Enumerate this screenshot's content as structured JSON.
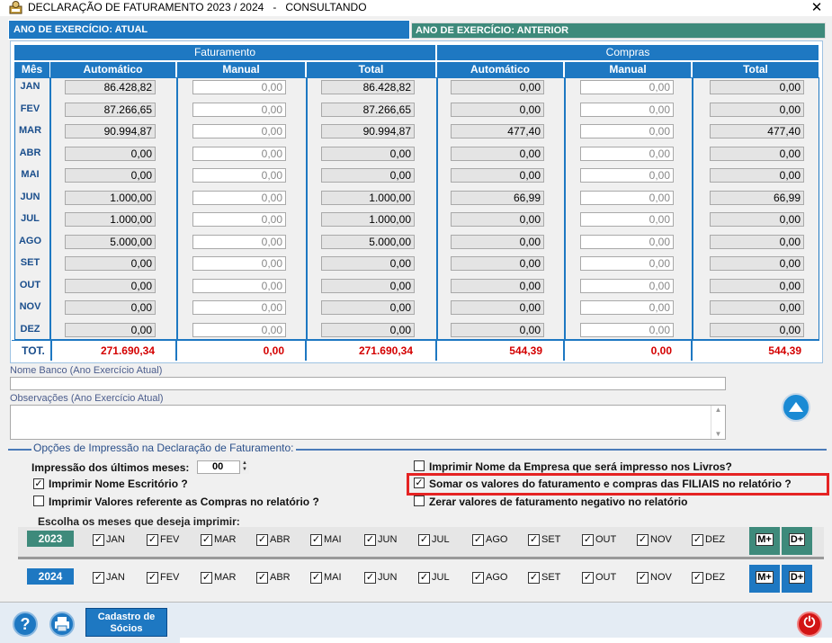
{
  "window": {
    "title": "DECLARAÇÃO DE FATURAMENTO 2023 / 2024   -   CONSULTANDO",
    "close_label": "✕"
  },
  "tabs": {
    "atual": "ANO DE EXERCÍCIO: ATUAL",
    "anterior": "ANO DE EXERCÍCIO: ANTERIOR"
  },
  "grid": {
    "group_faturamento": "Faturamento",
    "group_compras": "Compras",
    "col_mes": "Mês",
    "col_fat_auto": "Automático",
    "col_fat_manual": "Manual",
    "col_fat_total": "Total",
    "col_comp_auto": "Automático",
    "col_comp_manual": "Manual",
    "col_comp_total": "Total",
    "rows": [
      {
        "mes": "JAN",
        "fat_auto": "86.428,82",
        "fat_manual": "0,00",
        "fat_total": "86.428,82",
        "comp_auto": "0,00",
        "comp_manual": "0,00",
        "comp_total": "0,00"
      },
      {
        "mes": "FEV",
        "fat_auto": "87.266,65",
        "fat_manual": "0,00",
        "fat_total": "87.266,65",
        "comp_auto": "0,00",
        "comp_manual": "0,00",
        "comp_total": "0,00"
      },
      {
        "mes": "MAR",
        "fat_auto": "90.994,87",
        "fat_manual": "0,00",
        "fat_total": "90.994,87",
        "comp_auto": "477,40",
        "comp_manual": "0,00",
        "comp_total": "477,40"
      },
      {
        "mes": "ABR",
        "fat_auto": "0,00",
        "fat_manual": "0,00",
        "fat_total": "0,00",
        "comp_auto": "0,00",
        "comp_manual": "0,00",
        "comp_total": "0,00"
      },
      {
        "mes": "MAI",
        "fat_auto": "0,00",
        "fat_manual": "0,00",
        "fat_total": "0,00",
        "comp_auto": "0,00",
        "comp_manual": "0,00",
        "comp_total": "0,00"
      },
      {
        "mes": "JUN",
        "fat_auto": "1.000,00",
        "fat_manual": "0,00",
        "fat_total": "1.000,00",
        "comp_auto": "66,99",
        "comp_manual": "0,00",
        "comp_total": "66,99"
      },
      {
        "mes": "JUL",
        "fat_auto": "1.000,00",
        "fat_manual": "0,00",
        "fat_total": "1.000,00",
        "comp_auto": "0,00",
        "comp_manual": "0,00",
        "comp_total": "0,00"
      },
      {
        "mes": "AGO",
        "fat_auto": "5.000,00",
        "fat_manual": "0,00",
        "fat_total": "5.000,00",
        "comp_auto": "0,00",
        "comp_manual": "0,00",
        "comp_total": "0,00"
      },
      {
        "mes": "SET",
        "fat_auto": "0,00",
        "fat_manual": "0,00",
        "fat_total": "0,00",
        "comp_auto": "0,00",
        "comp_manual": "0,00",
        "comp_total": "0,00"
      },
      {
        "mes": "OUT",
        "fat_auto": "0,00",
        "fat_manual": "0,00",
        "fat_total": "0,00",
        "comp_auto": "0,00",
        "comp_manual": "0,00",
        "comp_total": "0,00"
      },
      {
        "mes": "NOV",
        "fat_auto": "0,00",
        "fat_manual": "0,00",
        "fat_total": "0,00",
        "comp_auto": "0,00",
        "comp_manual": "0,00",
        "comp_total": "0,00"
      },
      {
        "mes": "DEZ",
        "fat_auto": "0,00",
        "fat_manual": "0,00",
        "fat_total": "0,00",
        "comp_auto": "0,00",
        "comp_manual": "0,00",
        "comp_total": "0,00"
      }
    ],
    "totals": {
      "label": "TOT.",
      "fat_auto": "271.690,34",
      "fat_manual": "0,00",
      "fat_total": "271.690,34",
      "comp_auto": "544,39",
      "comp_manual": "0,00",
      "comp_total": "544,39"
    }
  },
  "fields": {
    "nome_banco_label": "Nome Banco (Ano Exercício Atual)",
    "obs_label": "Observações (Ano Exercício Atual)"
  },
  "options": {
    "legend": "Opções de Impressão na Declaração de Faturamento:",
    "meses_label": "Impressão dos últimos meses:",
    "meses_value": "00",
    "nome_escritorio": {
      "label": "Imprimir Nome Escritório ?",
      "checked": true
    },
    "valores_compras": {
      "label": "Imprimir Valores referente as Compras no relatório ?",
      "checked": false
    },
    "nome_empresa": {
      "label": "Imprimir Nome da Empresa que será impresso nos Livros?",
      "checked": false
    },
    "somar_filiais": {
      "label": "Somar os valores do faturamento e compras das FILIAIS no relatório ?",
      "checked": true
    },
    "zerar_negativo": {
      "label": "Zerar valores de faturamento negativo no relatório",
      "checked": false
    }
  },
  "months_selection": {
    "legend": "Escolha os meses que deseja imprimir:",
    "year1": "2023",
    "year2": "2024",
    "months": [
      "JAN",
      "FEV",
      "MAR",
      "ABR",
      "MAI",
      "JUN",
      "JUL",
      "AGO",
      "SET",
      "OUT",
      "NOV",
      "DEZ"
    ],
    "btn_mark_all": "M+",
    "btn_unmark": "D+"
  },
  "bottom": {
    "help_label": "?",
    "socios_label": "Cadastro de Sócios",
    "power_label": "⏻"
  },
  "colors": {
    "header_blue": "#1e78c2",
    "tab_green": "#3e8a7b",
    "total_red": "#d40000",
    "highlight_red": "#e52323"
  }
}
